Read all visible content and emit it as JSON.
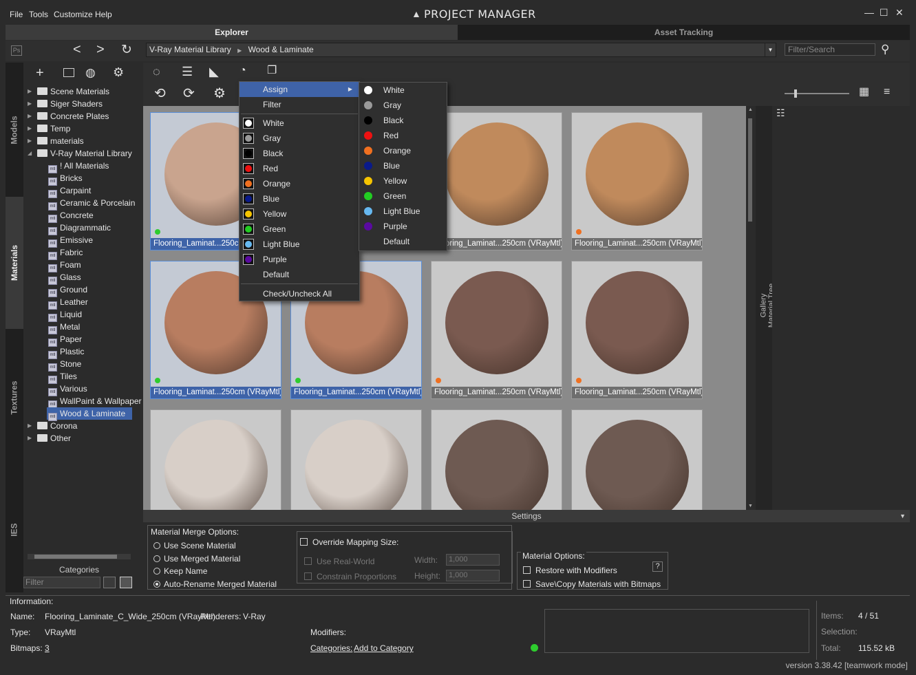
{
  "menubar": {
    "file": "File",
    "tools": "Tools",
    "customize": "Customize",
    "help": "Help"
  },
  "app_title": "PROJECT MANAGER",
  "tabs": {
    "explorer": "Explorer",
    "asset_tracking": "Asset Tracking"
  },
  "breadcrumb": {
    "root": "V-Ray Material Library",
    "current": "Wood & Laminate"
  },
  "search": {
    "placeholder": "Filter/Search"
  },
  "side_tabs": {
    "models": "Models",
    "materials": "Materials",
    "textures": "Textures",
    "ies": "IES"
  },
  "tree": {
    "folders": [
      "Scene Materials",
      "Siger Shaders",
      "Concrete Plates",
      "Temp",
      "materials",
      "V-Ray Material Library"
    ],
    "library_items": [
      "! All Materials",
      "Bricks",
      "Carpaint",
      "Ceramic & Porcelain",
      "Concrete",
      "Diagrammatic",
      "Emissive",
      "Fabric",
      "Foam",
      "Glass",
      "Ground",
      "Leather",
      "Liquid",
      "Metal",
      "Paper",
      "Plastic",
      "Stone",
      "Tiles",
      "Various",
      "WallPaint & Wallpaper",
      "Wood & Laminate"
    ],
    "selected": "Wood & Laminate",
    "bottom_folders": [
      "Corona",
      "Other"
    ]
  },
  "categories": {
    "label": "Categories",
    "filter_placeholder": "Filter"
  },
  "gallery": {
    "cards": [
      {
        "caption": "Flooring_Laminat...250cm (VRayMtl)",
        "dot": "#2ecc2e",
        "color": "#c9a48e",
        "selected": true
      },
      {
        "caption": "Flooring_Laminat...250cm (VRayMtl)",
        "dot": "",
        "color": "#c49270",
        "selected": false
      },
      {
        "caption": "Flooring_Laminat...250cm (VRayMtl)",
        "dot": "",
        "color": "#c08a5c",
        "selected": false
      },
      {
        "caption": "Flooring_Laminat...250cm (VRayMtl)",
        "dot": "#f07020",
        "color": "#c08a5c",
        "selected": false
      },
      {
        "caption": "Flooring_Laminat...250cm (VRayMtl)",
        "dot": "#2ecc2e",
        "color": "#b87d60",
        "selected": true
      },
      {
        "caption": "Flooring_Laminat...250cm (VRayMtl)",
        "dot": "#2ecc2e",
        "color": "#b87d60",
        "selected": true
      },
      {
        "caption": "Flooring_Laminat...250cm (VRayMtl)",
        "dot": "#f07020",
        "color": "#7a5a50",
        "selected": false
      },
      {
        "caption": "Flooring_Laminat...250cm (VRayMtl)",
        "dot": "#f07020",
        "color": "#7a5a50",
        "selected": false
      },
      {
        "caption": "",
        "dot": "",
        "color": "#d8cfc8",
        "selected": false
      },
      {
        "caption": "",
        "dot": "",
        "color": "#d8cfc8",
        "selected": false
      },
      {
        "caption": "",
        "dot": "",
        "color": "#6e5a52",
        "selected": false
      },
      {
        "caption": "",
        "dot": "",
        "color": "#6e5a52",
        "selected": false
      }
    ]
  },
  "right_strip": {
    "gallery": "Gallery",
    "material_tree": "Material Tree"
  },
  "context_menu": {
    "assign": "Assign",
    "filter": "Filter",
    "colors": [
      {
        "label": "White",
        "color": "#ffffff"
      },
      {
        "label": "Gray",
        "color": "#9a9a9a"
      },
      {
        "label": "Black",
        "color": "#000000"
      },
      {
        "label": "Red",
        "color": "#ee1111"
      },
      {
        "label": "Orange",
        "color": "#f07020"
      },
      {
        "label": "Blue",
        "color": "#0a1a8a"
      },
      {
        "label": "Yellow",
        "color": "#f5c400"
      },
      {
        "label": "Green",
        "color": "#22cc22"
      },
      {
        "label": "Light Blue",
        "color": "#66b8f0"
      },
      {
        "label": "Purple",
        "color": "#5a0aa0"
      }
    ],
    "default": "Default",
    "check_all": "Check/Uncheck All"
  },
  "settings": {
    "title": "Settings",
    "merge_options": "Material Merge Options:",
    "radios": [
      "Use Scene Material",
      "Use Merged Material",
      "Keep Name",
      "Auto-Rename Merged Material"
    ],
    "radio_selected": 3,
    "override": "Override Mapping Size:",
    "use_real_world": "Use Real-World",
    "constrain": "Constrain Proportions",
    "width_label": "Width:",
    "height_label": "Height:",
    "width_value": "1,000",
    "height_value": "1,000",
    "material_options": "Material Options:",
    "restore": "Restore with Modifiers",
    "save_copy": "Save\\Copy Materials with Bitmaps",
    "help": "?"
  },
  "info": {
    "title": "Information:",
    "name_label": "Name:",
    "name_value": "Flooring_Laminate_C_Wide_250cm (VRayMtl)",
    "renderers_label": "Renderers:",
    "renderers_value": "V-Ray",
    "type_label": "Type:",
    "type_value": "VRayMtl",
    "bitmaps_label": "Bitmaps:",
    "bitmaps_value": "3",
    "modifiers_label": "Modifiers:",
    "categories_label": "Categories:",
    "add_category": "Add to Category",
    "items_label": "Items:",
    "items_value": "4 / 51",
    "selection_label": "Selection:",
    "total_label": "Total:",
    "total_value": "115.52 kB"
  },
  "version": "version 3.38.42 [teamwork mode]"
}
